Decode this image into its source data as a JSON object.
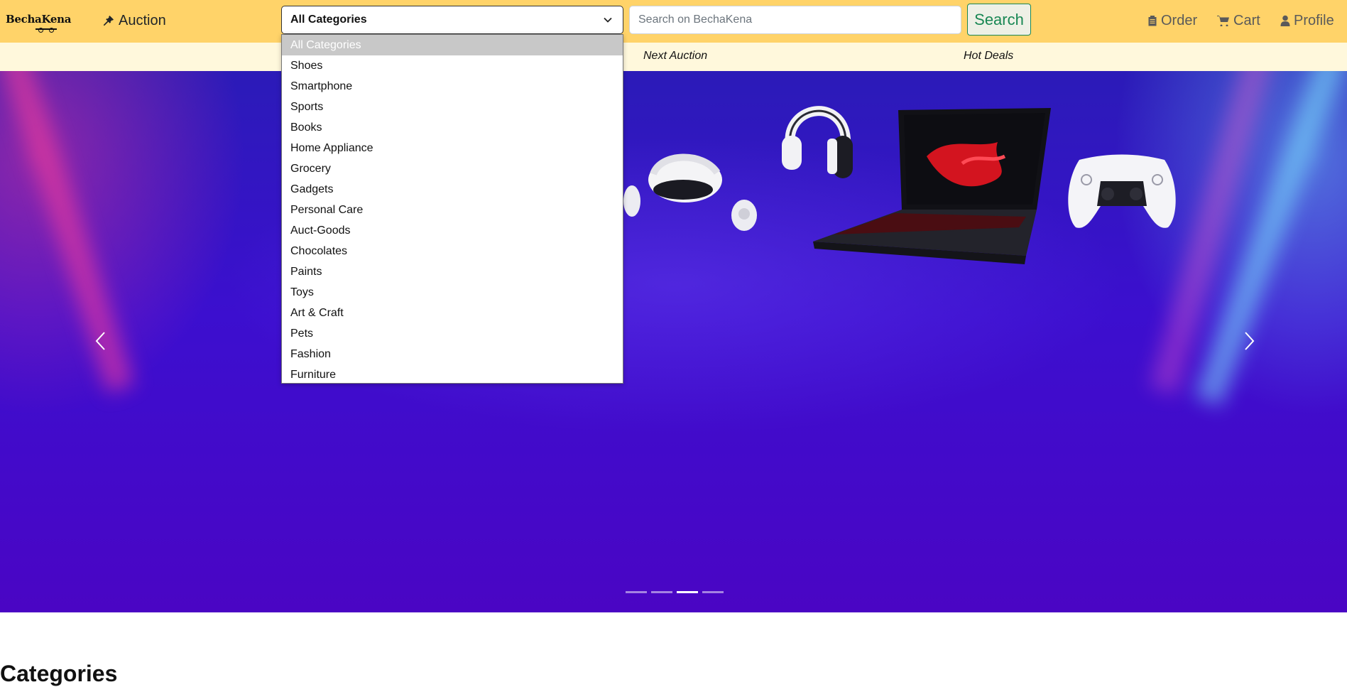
{
  "brand": {
    "logo_text": "BechaKena"
  },
  "navbar": {
    "auction_label": "Auction",
    "category_select": {
      "value": "All Categories"
    },
    "search": {
      "placeholder": "Search on BechaKena",
      "button_label": "Search"
    },
    "order_label": "Order",
    "cart_label": "Cart",
    "profile_label": "Profile"
  },
  "subnav": {
    "items": [
      "Next Auction",
      "Hot Deals"
    ]
  },
  "carousel": {
    "slide_count": 4,
    "active_slide": 3
  },
  "dropdown": {
    "selected": "All Categories",
    "options": [
      "All Categories",
      "Shoes",
      "Smartphone",
      "Sports",
      "Books",
      "Home Appliance",
      "Grocery",
      "Gadgets",
      "Personal Care",
      "Auct-Goods",
      "Chocolates",
      "Paints",
      "Toys",
      "Art & Craft",
      "Pets",
      "Fashion",
      "Furniture"
    ]
  },
  "sections": {
    "categories_title": "Categories"
  },
  "colors": {
    "navbar_bg": "#ffd369",
    "subnav_bg": "#fff8dc",
    "search_button": "#198754",
    "banner": "#4a05c4"
  }
}
